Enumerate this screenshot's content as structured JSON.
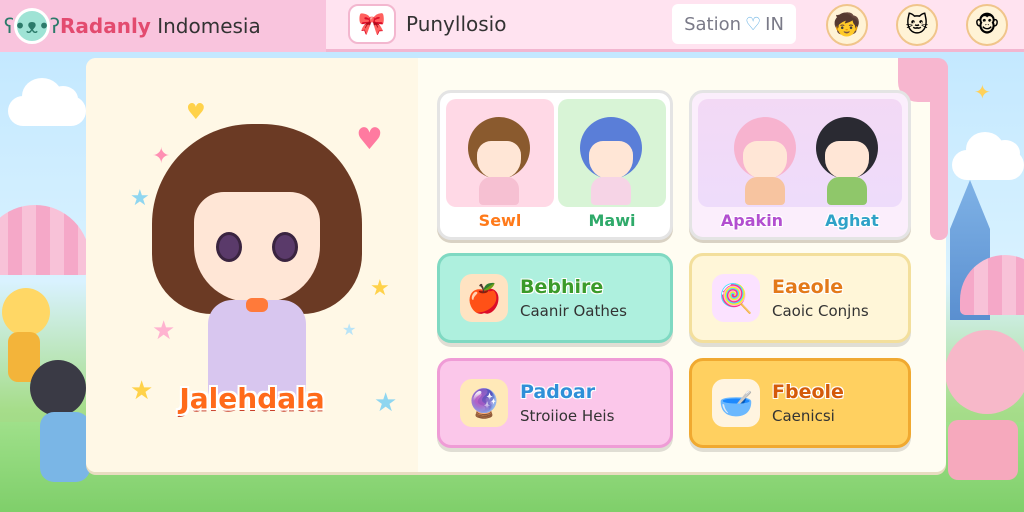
{
  "header": {
    "brand": "Radanly",
    "title_rest": " Indomesia",
    "tab_title": "Punyllosio",
    "section_label": "Sation",
    "section_suffix": "IN"
  },
  "hero": {
    "name": "Jalehdala"
  },
  "characters": [
    {
      "name": "Sewl",
      "color": "#ff7a1a"
    },
    {
      "name": "Mawi",
      "color": "#2faa6a"
    },
    {
      "name": "Apakin",
      "color": "#b24fd0"
    },
    {
      "name": "Aghat",
      "color": "#2fa2c8"
    }
  ],
  "menu": [
    {
      "title": "Bebhire",
      "subtitle": "Caanir Oathes",
      "icon": "apple-stand-icon"
    },
    {
      "title": "Eaeole",
      "subtitle": "Caoic Conjns",
      "icon": "wand-icon"
    },
    {
      "title": "Padoar",
      "subtitle": "Stroiioe Heis",
      "icon": "orbs-icon"
    },
    {
      "title": "Fbeole",
      "subtitle": "Caenicsi",
      "icon": "bowl-icon"
    }
  ],
  "colors": {
    "topbar": "#ffe3f0",
    "brand": "#e34b6f",
    "hero_name": "#ff6a1a"
  }
}
